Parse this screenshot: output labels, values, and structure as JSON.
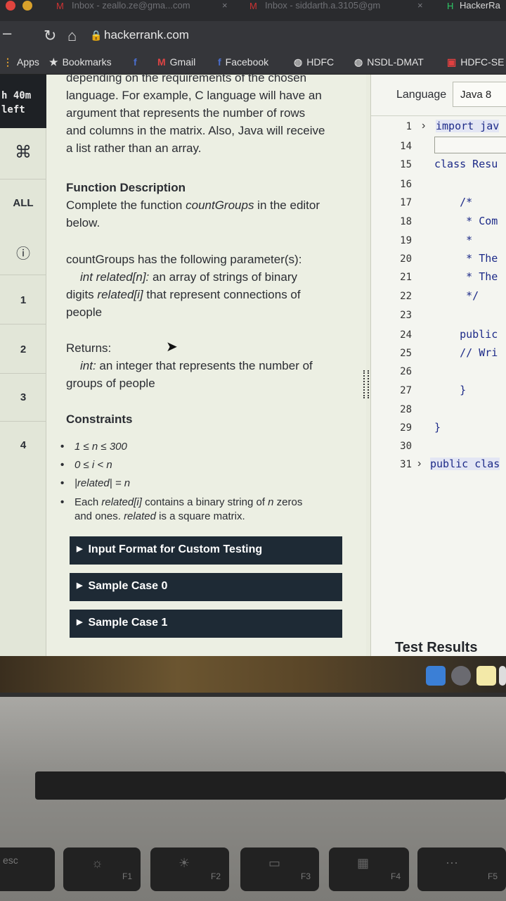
{
  "browser": {
    "tabs": [
      {
        "title": "Inbox - zeallo.ze@gma...com"
      },
      {
        "title": "Inbox - siddarth.a.3105@gm"
      },
      {
        "title": "HackerRa"
      }
    ],
    "url": "hackerrank.com",
    "bookmarks": [
      {
        "label": "Apps",
        "icon": "apps-grid-icon"
      },
      {
        "label": "Bookmarks",
        "icon": "star-icon"
      },
      {
        "label": "",
        "icon": "facebook-icon"
      },
      {
        "label": "Gmail",
        "icon": "gmail-icon"
      },
      {
        "label": "Facebook",
        "icon": "facebook-icon"
      },
      {
        "label": "HDFC",
        "icon": "globe-icon"
      },
      {
        "label": "NSDL-DMAT",
        "icon": "globe-icon"
      },
      {
        "label": "HDFC-SE",
        "icon": "hdfc-icon"
      }
    ]
  },
  "sidebar": {
    "timer_line1": "h 40m",
    "timer_line2": "left",
    "cmd_symbol": "⌘",
    "items": [
      "ALL",
      "ⓘ",
      "1",
      "2",
      "3",
      "4"
    ]
  },
  "problem": {
    "intro_top": "depending on the requirements of the chosen",
    "intro_l1": "language. For example, C language will have an",
    "intro_l2": "argument that represents the number of rows",
    "intro_l3": "and columns in the matrix. Also, Java will receive",
    "intro_l4": "a list rather than an array.",
    "fd_heading": "Function Description",
    "fd_line1_a": "Complete the function ",
    "fd_line1_fn": "countGroups",
    "fd_line1_b": " in the editor",
    "fd_line2": "below.",
    "params_heading": "countGroups has the following parameter(s):",
    "param_sig": "int related[n]:",
    "param_desc1": "  an array of strings of binary",
    "param_desc2_a": "digits ",
    "param_desc2_em": "related[i]",
    "param_desc2_b": " that represent connections of",
    "param_desc3": "people",
    "returns_heading": "Returns:",
    "returns_type": "int:",
    "returns_desc1": " an integer that represents the number of",
    "returns_desc2": "groups of people",
    "constraints_heading": "Constraints",
    "c1": "1 ≤ n ≤ 300",
    "c2": "0 ≤ i < n",
    "c3": "|related| = n",
    "c4_a": "Each ",
    "c4_em1": "related[i]",
    "c4_b": " contains a binary string of ",
    "c4_em2": "n",
    "c4_c": " zeros",
    "c4_l2_a": "and ones. ",
    "c4_l2_em": "related",
    "c4_l2_b": " is a square matrix.",
    "accordions": [
      "Input Format for Custom Testing",
      "Sample Case 0",
      "Sample Case 1"
    ]
  },
  "editor": {
    "language_label": "Language",
    "language_value": "Java 8",
    "lines": [
      {
        "n": "1",
        "code": "import jav"
      },
      {
        "n": "14",
        "code": ""
      },
      {
        "n": "15",
        "code": "class Resu"
      },
      {
        "n": "16",
        "code": ""
      },
      {
        "n": "17",
        "code": "    /*"
      },
      {
        "n": "18",
        "code": "     * Com"
      },
      {
        "n": "19",
        "code": "     *"
      },
      {
        "n": "20",
        "code": "     * The"
      },
      {
        "n": "21",
        "code": "     * The"
      },
      {
        "n": "22",
        "code": "     */"
      },
      {
        "n": "23",
        "code": ""
      },
      {
        "n": "24",
        "code": "    public"
      },
      {
        "n": "25",
        "code": "    // Wri"
      },
      {
        "n": "26",
        "code": ""
      },
      {
        "n": "27",
        "code": "    }"
      },
      {
        "n": "28",
        "code": ""
      },
      {
        "n": "29",
        "code": "}"
      },
      {
        "n": "30",
        "code": ""
      },
      {
        "n": "31",
        "code": "public clas"
      }
    ],
    "test_results": "Test Results"
  },
  "keyboard": {
    "keys": [
      {
        "label": "esc"
      },
      {
        "label": "F1",
        "sym": "☼"
      },
      {
        "label": "F2",
        "sym": "☀"
      },
      {
        "label": "F3",
        "sym": "▭"
      },
      {
        "label": "F4",
        "sym": "▦"
      },
      {
        "label": "F5",
        "sym": "⋯"
      }
    ]
  },
  "colors": {
    "timer_bg": "#1e2125",
    "accordion_bg": "#1e2a35",
    "code_blue": "#1c2a88"
  }
}
